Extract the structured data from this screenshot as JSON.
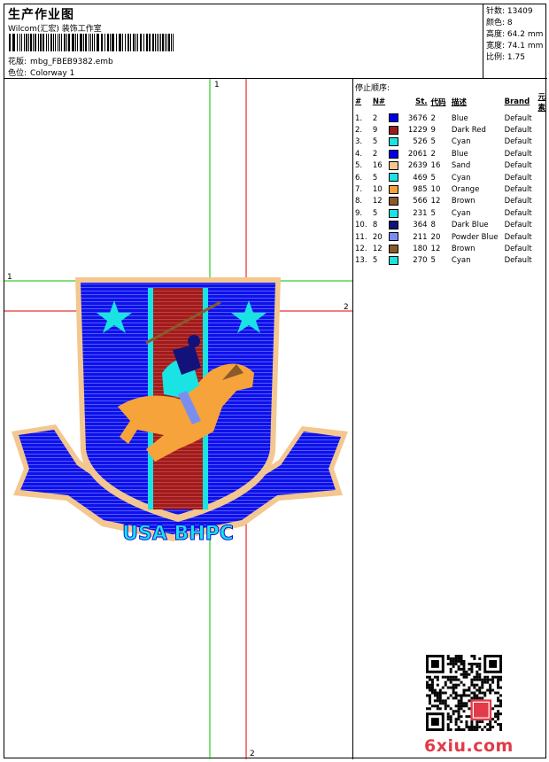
{
  "header": {
    "title": "生产作业图",
    "studio": "Wilcom(汇宏) 装饰工作室",
    "design_label": "花版:",
    "design_file": "mbg_FBEB9382.emb",
    "colorway_label": "色位:",
    "colorway": "Colorway 1"
  },
  "specs": [
    {
      "label": "针数:",
      "value": "13409"
    },
    {
      "label": "颜色:",
      "value": "8"
    },
    {
      "label": "高度:",
      "value": "64.2 mm"
    },
    {
      "label": "宽度:",
      "value": "74.1 mm"
    },
    {
      "label": "比例:",
      "value": "1.75"
    }
  ],
  "sequence": {
    "title": "停止顺序:",
    "headers": [
      "#",
      "N#",
      "St.",
      "代码",
      "描述",
      "Brand",
      "元素"
    ],
    "rows": [
      {
        "no": "1.",
        "n": "2",
        "color": "#0000e6",
        "st": "3676",
        "code": "2",
        "desc": "Blue",
        "brand": "Default"
      },
      {
        "no": "2.",
        "n": "9",
        "color": "#9b1b1b",
        "st": "1229",
        "code": "9",
        "desc": "Dark Red",
        "brand": "Default"
      },
      {
        "no": "3.",
        "n": "5",
        "color": "#19e3e3",
        "st": "526",
        "code": "5",
        "desc": "Cyan",
        "brand": "Default"
      },
      {
        "no": "4.",
        "n": "2",
        "color": "#0000e6",
        "st": "2061",
        "code": "2",
        "desc": "Blue",
        "brand": "Default"
      },
      {
        "no": "5.",
        "n": "16",
        "color": "#f3c78f",
        "st": "2639",
        "code": "16",
        "desc": "Sand",
        "brand": "Default"
      },
      {
        "no": "6.",
        "n": "5",
        "color": "#19e3e3",
        "st": "469",
        "code": "5",
        "desc": "Cyan",
        "brand": "Default"
      },
      {
        "no": "7.",
        "n": "10",
        "color": "#f5a33a",
        "st": "985",
        "code": "10",
        "desc": "Orange",
        "brand": "Default"
      },
      {
        "no": "8.",
        "n": "12",
        "color": "#8a5a2b",
        "st": "566",
        "code": "12",
        "desc": "Brown",
        "brand": "Default"
      },
      {
        "no": "9.",
        "n": "5",
        "color": "#19e3e3",
        "st": "231",
        "code": "5",
        "desc": "Cyan",
        "brand": "Default"
      },
      {
        "no": "10.",
        "n": "8",
        "color": "#12127a",
        "st": "364",
        "code": "8",
        "desc": "Dark Blue",
        "brand": "Default"
      },
      {
        "no": "11.",
        "n": "20",
        "color": "#7a8ef0",
        "st": "211",
        "code": "20",
        "desc": "Powder Blue",
        "brand": "Default"
      },
      {
        "no": "12.",
        "n": "12",
        "color": "#8a5a2b",
        "st": "180",
        "code": "12",
        "desc": "Brown",
        "brand": "Default"
      },
      {
        "no": "13.",
        "n": "5",
        "color": "#19e3e3",
        "st": "270",
        "code": "5",
        "desc": "Cyan",
        "brand": "Default"
      }
    ]
  },
  "guides": {
    "v1": "1",
    "v2": "2",
    "h1": "1",
    "h2": "2"
  },
  "badge": {
    "ribbon_text": "USA BHPC"
  },
  "footer": {
    "brand": "6xiu.com"
  },
  "colors": {
    "blue": "#0000e6",
    "dark_red": "#9b1b1b",
    "cyan": "#19e3e3",
    "sand": "#f3c78f",
    "orange": "#f5a33a",
    "guide_green": "#00c000",
    "guide_red": "#e00000"
  }
}
